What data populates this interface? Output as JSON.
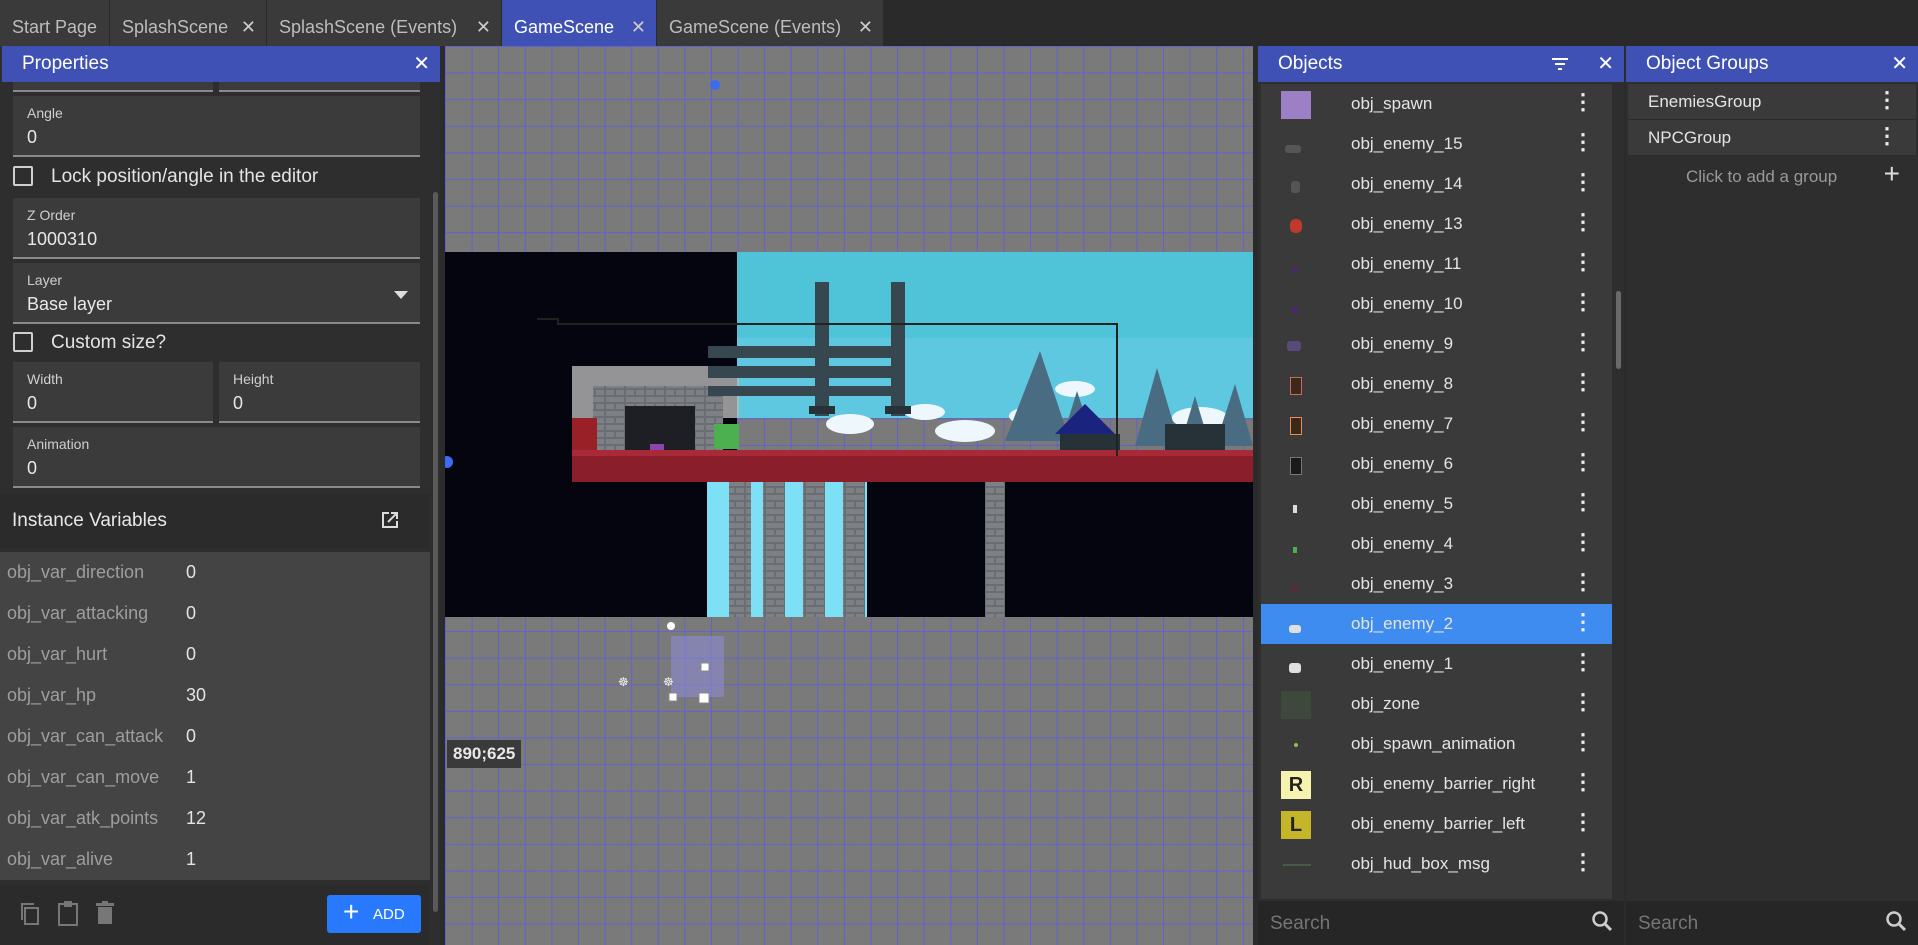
{
  "tabs": [
    {
      "label": "Start Page",
      "closable": false,
      "active": false
    },
    {
      "label": "SplashScene",
      "closable": true,
      "active": false
    },
    {
      "label": "SplashScene (Events)",
      "closable": true,
      "active": false
    },
    {
      "label": "GameScene",
      "closable": true,
      "active": true
    },
    {
      "label": "GameScene (Events)",
      "closable": true,
      "active": false
    }
  ],
  "properties": {
    "title": "Properties",
    "angle": {
      "label": "Angle",
      "value": "0"
    },
    "lock": {
      "label": "Lock position/angle in the editor"
    },
    "zorder": {
      "label": "Z Order",
      "value": "1000310"
    },
    "layer": {
      "label": "Layer",
      "value": "Base layer"
    },
    "custom_size": {
      "label": "Custom size?"
    },
    "width": {
      "label": "Width",
      "value": "0"
    },
    "height": {
      "label": "Height",
      "value": "0"
    },
    "animation": {
      "label": "Animation",
      "value": "0"
    },
    "instance_vars_title": "Instance Variables",
    "variables": [
      {
        "name": "obj_var_direction",
        "value": "0"
      },
      {
        "name": "obj_var_attacking",
        "value": "0"
      },
      {
        "name": "obj_var_hurt",
        "value": "0"
      },
      {
        "name": "obj_var_hp",
        "value": "30"
      },
      {
        "name": "obj_var_can_attack",
        "value": "0"
      },
      {
        "name": "obj_var_can_move",
        "value": "1"
      },
      {
        "name": "obj_var_atk_points",
        "value": "12"
      },
      {
        "name": "obj_var_alive",
        "value": "1"
      }
    ],
    "add_label": "ADD"
  },
  "canvas": {
    "coordinates": "890;625"
  },
  "objects": {
    "title": "Objects",
    "items": [
      {
        "name": "obj_spawn",
        "thumb": "purple-square"
      },
      {
        "name": "obj_enemy_15",
        "thumb": "enemy-sprite"
      },
      {
        "name": "obj_enemy_14",
        "thumb": "enemy-sprite"
      },
      {
        "name": "obj_enemy_13",
        "thumb": "enemy-sprite"
      },
      {
        "name": "obj_enemy_11",
        "thumb": "enemy-sprite"
      },
      {
        "name": "obj_enemy_10",
        "thumb": "enemy-sprite"
      },
      {
        "name": "obj_enemy_9",
        "thumb": "enemy-sprite"
      },
      {
        "name": "obj_enemy_8",
        "thumb": "enemy-sprite"
      },
      {
        "name": "obj_enemy_7",
        "thumb": "enemy-sprite"
      },
      {
        "name": "obj_enemy_6",
        "thumb": "enemy-sprite"
      },
      {
        "name": "obj_enemy_5",
        "thumb": "enemy-sprite"
      },
      {
        "name": "obj_enemy_4",
        "thumb": "enemy-sprite"
      },
      {
        "name": "obj_enemy_3",
        "thumb": "enemy-sprite"
      },
      {
        "name": "obj_enemy_2",
        "thumb": "enemy-sprite",
        "selected": true
      },
      {
        "name": "obj_enemy_1",
        "thumb": "enemy-sprite"
      },
      {
        "name": "obj_zone",
        "thumb": "green-square"
      },
      {
        "name": "obj_spawn_animation",
        "thumb": "dot-sprite"
      },
      {
        "name": "obj_enemy_barrier_right",
        "thumb": "R-icon",
        "thumb_text": "R"
      },
      {
        "name": "obj_enemy_barrier_left",
        "thumb": "L-icon",
        "thumb_text": "L"
      },
      {
        "name": "obj_hud_box_msg",
        "thumb": "line-sprite"
      }
    ],
    "search_placeholder": "Search"
  },
  "groups": {
    "title": "Object Groups",
    "items": [
      {
        "name": "EnemiesGroup"
      },
      {
        "name": "NPCGroup"
      }
    ],
    "add_text": "Click to add a group",
    "search_placeholder": "Search"
  },
  "colors": {
    "accent": "#3f51b5",
    "selected": "#3f8cf0",
    "panel": "#2e2e2e",
    "row": "#3a3a3a"
  }
}
